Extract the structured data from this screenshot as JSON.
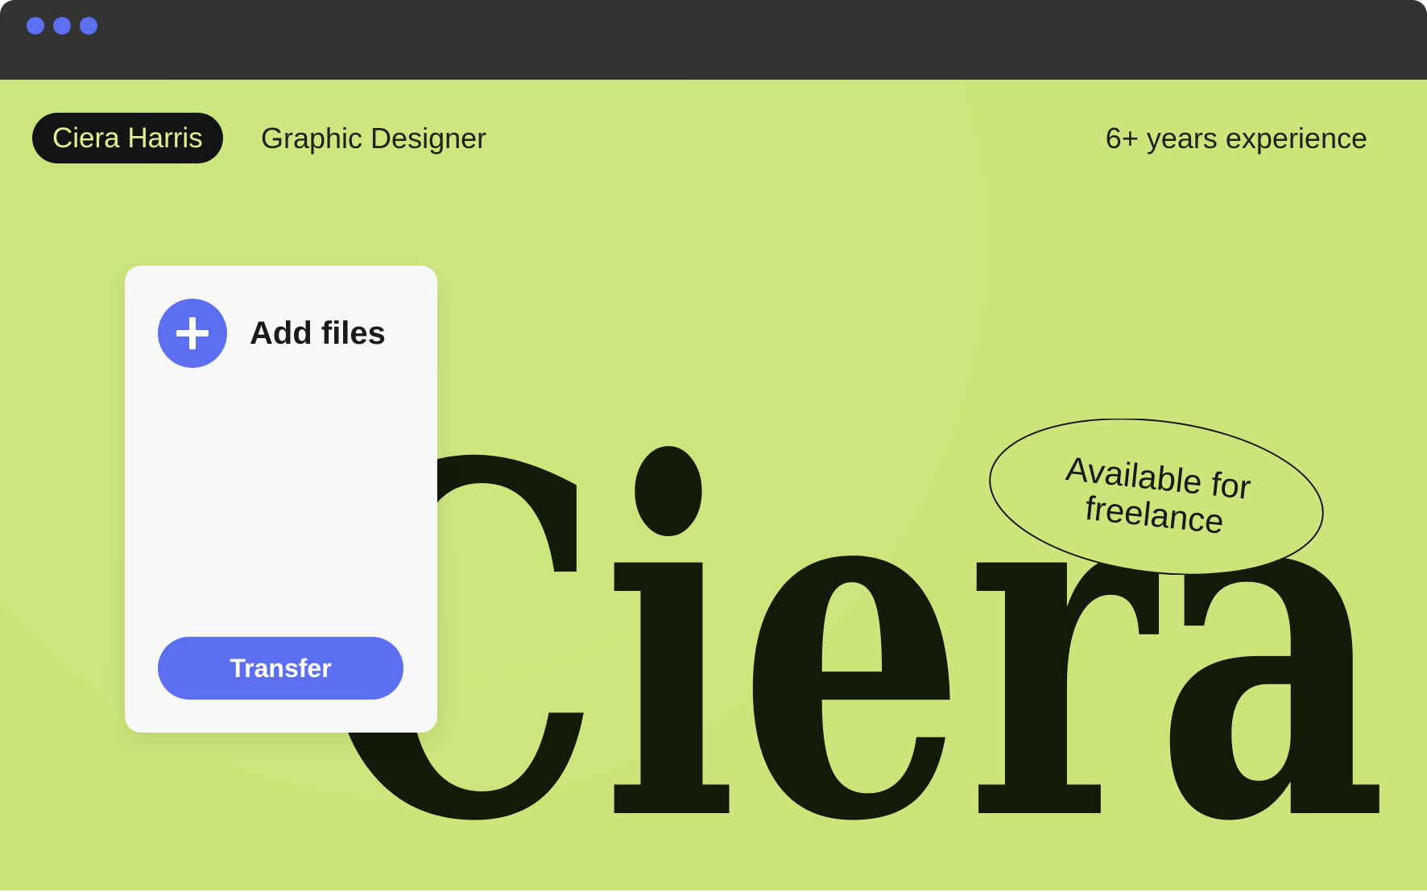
{
  "window": {
    "traffic_lights": [
      "dot-1",
      "dot-2",
      "dot-3"
    ],
    "traffic_light_color": "#5b6ff0"
  },
  "header": {
    "name": "Ciera Harris",
    "role": "Graphic Designer",
    "experience": "6+ years experience"
  },
  "hero": {
    "word": "Ciera"
  },
  "upload_card": {
    "add_icon": "plus-icon",
    "add_label": "Add files",
    "transfer_label": "Transfer"
  },
  "badge": {
    "line1": "Available for",
    "line2": "freelance"
  },
  "colors": {
    "background": "#cbe57a",
    "titlebar": "#333333",
    "accent": "#5b6ff0",
    "dark": "#141a08"
  }
}
